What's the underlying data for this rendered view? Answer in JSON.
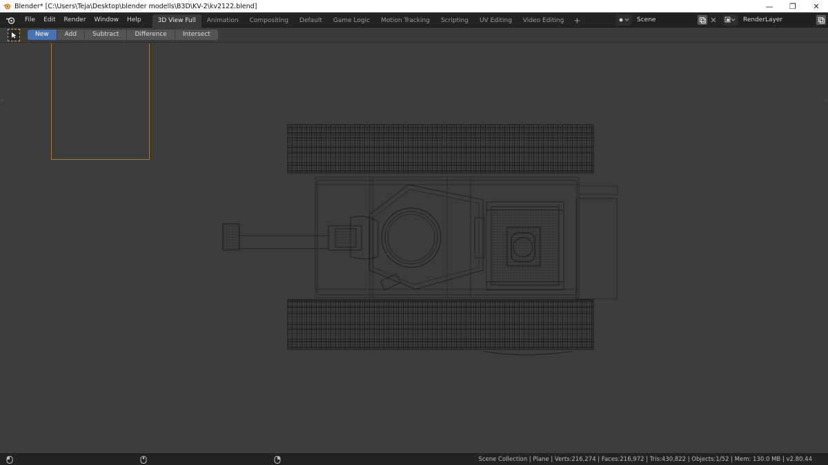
{
  "window": {
    "title": "Blender* [C:\\Users\\Teja\\Desktop\\blender modells\\B3D\\KV-2\\kv2122.blend]",
    "controls": {
      "minimize": "—",
      "maximize": "❐",
      "close": "✕"
    }
  },
  "topbar": {
    "menus": [
      "File",
      "Edit",
      "Render",
      "Window",
      "Help"
    ],
    "workspaces": [
      "3D View Full",
      "Animation",
      "Compositing",
      "Default",
      "Game Logic",
      "Motion Tracking",
      "Scripting",
      "UV Editing",
      "Video Editing"
    ],
    "active_workspace": "3D View Full",
    "add_workspace": "+",
    "scene": "Scene",
    "render_layer": "RenderLayer"
  },
  "toolbar": {
    "boolean_ops": [
      "New",
      "Add",
      "Subtract",
      "Difference",
      "Intersect"
    ],
    "active_op": "New"
  },
  "statusbar": {
    "text": "Scene Collection | Plane | Verts:216,274 | Faces:216,972 | Tris:430,822 | Objects:1/52 | Mem: 130.0 MB | v2.80.44"
  },
  "colors": {
    "accent": "#4772b3",
    "selection_outline": "#d9a23c",
    "viewport_bg": "#3c3c3c"
  }
}
